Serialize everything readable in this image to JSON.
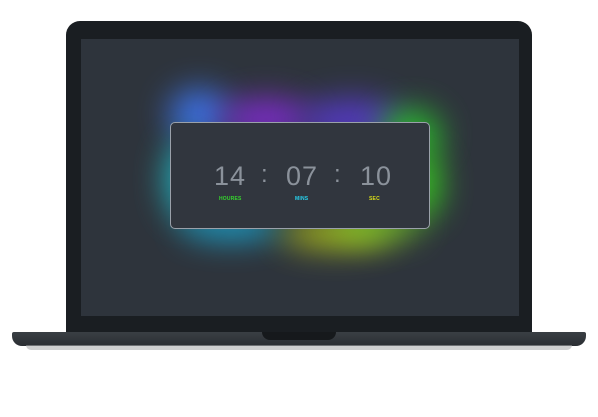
{
  "clock": {
    "hours": "14",
    "minutes": "07",
    "seconds": "10",
    "separator": ":",
    "hours_label": "HOURES",
    "minutes_label": "MINS",
    "seconds_label": "SEC"
  },
  "colors": {
    "hours_label_color": "#35d62d",
    "minutes_label_color": "#27d4f0",
    "seconds_label_color": "#d8dc18",
    "digit_color": "#8b929b",
    "card_background": "#31363e",
    "screen_background": "#2e343c",
    "laptop_body": "#1a1e22"
  },
  "icons": {
    "device": "laptop-icon"
  }
}
